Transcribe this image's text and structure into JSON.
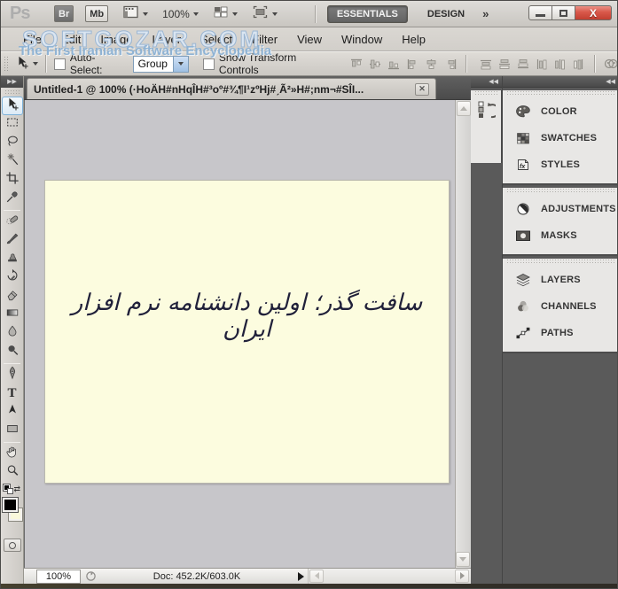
{
  "titlebar": {
    "logo": "Ps",
    "bridge": "Br",
    "minibridge": "Mb",
    "zoom": "100%",
    "workspaces": {
      "essentials": "ESSENTIALS",
      "design": "DESIGN",
      "more": "»"
    },
    "close_glyph": "X"
  },
  "menubar": {
    "items": [
      "File",
      "Edit",
      "Image",
      "Layer",
      "Select",
      "Filter",
      "View",
      "Window",
      "Help"
    ]
  },
  "watermark": {
    "line1": "SOFTGOZAR.COM",
    "line2": "The First Iranian Software Encyclopedia"
  },
  "optionsbar": {
    "auto_select": "Auto-Select:",
    "auto_select_value": "Group",
    "show_transform": "Show Transform Controls"
  },
  "document": {
    "tab_title": "Untitled-1 @ 100% (·HoÄH#nHqÎH#³oº#¾¶I¹zºHj#ˏÃ²»H#;nm¬#SÎI...",
    "tab_close_glyph": "✕",
    "canvas_text": "سافت گذر؛ اولین دانشنامه نرم افزار ایران"
  },
  "statusbar": {
    "zoom": "100%",
    "doc_info": "Doc: 452.2K/603.0K"
  },
  "panels": {
    "color": "COLOR",
    "swatches": "SWATCHES",
    "styles": "STYLES",
    "styles_icon_text": "fx",
    "adjustments": "ADJUSTMENTS",
    "masks": "MASKS",
    "layers": "LAYERS",
    "channels": "CHANNELS",
    "paths": "PATHS"
  },
  "tools": {
    "type_glyph": "T"
  },
  "collapse_glyphs": {
    "left": "◀◀",
    "right": "▶▶"
  },
  "colors": {
    "canvas": "#fcfcdf",
    "foreground": "#000000",
    "background": "#faf8da",
    "close_button": "#d8584a",
    "watermark_blue": "#8fb3d4",
    "app_dark_gray": "#5a5a5a"
  }
}
